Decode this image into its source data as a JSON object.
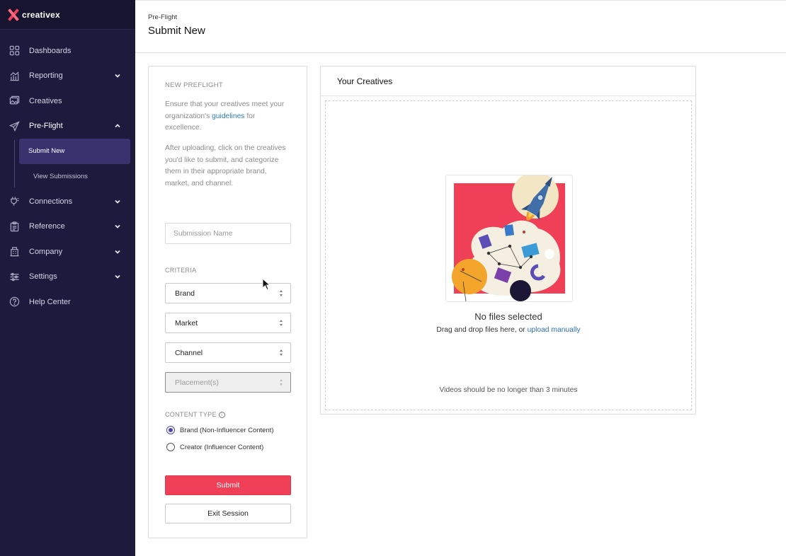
{
  "app": {
    "logo_text": "creativex"
  },
  "sidebar": {
    "items": [
      {
        "label": "Dashboards",
        "icon": "dashboard-grid-icon",
        "has_chevron": false
      },
      {
        "label": "Reporting",
        "icon": "reporting-chart-icon",
        "has_chevron": true
      },
      {
        "label": "Creatives",
        "icon": "creatives-images-icon",
        "has_chevron": false
      },
      {
        "label": "Pre-Flight",
        "icon": "paper-plane-icon",
        "has_chevron": true,
        "expanded": true
      },
      {
        "label": "Connections",
        "icon": "plug-icon",
        "has_chevron": true
      },
      {
        "label": "Reference",
        "icon": "clipboard-icon",
        "has_chevron": true
      },
      {
        "label": "Company",
        "icon": "building-icon",
        "has_chevron": true
      },
      {
        "label": "Settings",
        "icon": "sliders-icon",
        "has_chevron": true
      },
      {
        "label": "Help Center",
        "icon": "question-circle-icon",
        "has_chevron": false
      }
    ],
    "preflight_sub": [
      {
        "label": "Submit New",
        "active": true
      },
      {
        "label": "View Submissions",
        "active": false
      }
    ]
  },
  "header": {
    "breadcrumb": "Pre-Flight",
    "title": "Submit New"
  },
  "form": {
    "section_title": "NEW PREFLIGHT",
    "intro_before_link": "Ensure that your creatives meet your organization's ",
    "intro_link": "guidelines",
    "intro_after_link": " for excellence.",
    "instructions": "After uploading, click on the creatives you'd like to submit, and categorize them in their appropriate brand, market, and channel.",
    "submission_name_placeholder": "Submission Name",
    "criteria_label": "CRITERIA",
    "brand": "Brand",
    "market": "Market",
    "channel": "Channel",
    "placements": "Placement(s)",
    "content_type_label": "CONTENT TYPE",
    "content_type_options": [
      {
        "label": "Brand (Non-Influencer Content)",
        "checked": true
      },
      {
        "label": "Creator (Influencer Content)",
        "checked": false
      }
    ],
    "submit_label": "Submit",
    "exit_label": "Exit Session"
  },
  "creatives": {
    "title": "Your Creatives",
    "empty_title": "No files selected",
    "drag_text": "Drag and drop files here, or ",
    "upload_link": "upload manually",
    "video_note": "Videos should be no longer than 3 minutes"
  },
  "colors": {
    "sidebar_bg": "#1c1a3d",
    "active_sub_bg": "#38336e",
    "accent_red": "#ef4058",
    "link_blue": "#2f7fc8",
    "radio_purple": "#4a45b5"
  }
}
